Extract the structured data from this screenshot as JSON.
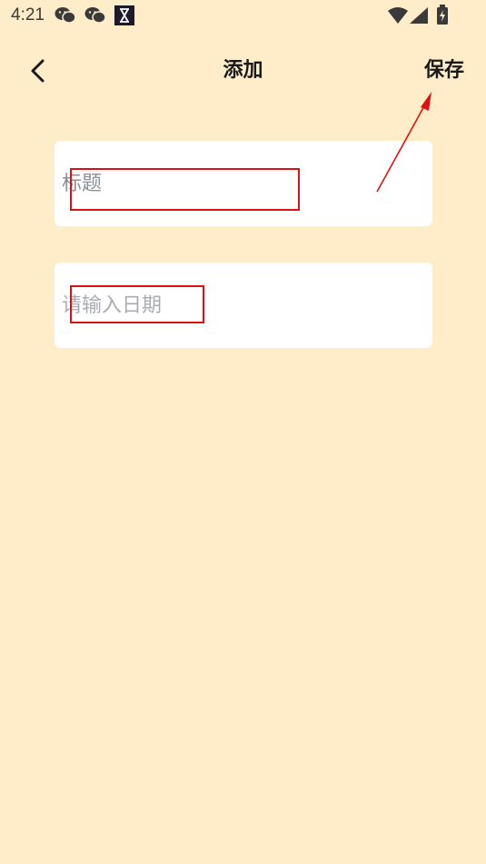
{
  "status_bar": {
    "time": "4:21",
    "icons": [
      "wechat-icon",
      "wechat-icon",
      "hourglass-icon",
      "wifi-icon",
      "signal-icon",
      "battery-charging-icon"
    ]
  },
  "header": {
    "title": "添加",
    "save_label": "保存"
  },
  "form": {
    "title_field": {
      "placeholder": "标题",
      "value": ""
    },
    "date_field": {
      "placeholder": "请输入日期",
      "value": ""
    }
  },
  "colors": {
    "background": "#feedc8",
    "card": "#ffffff",
    "annotation": "#e11010"
  }
}
